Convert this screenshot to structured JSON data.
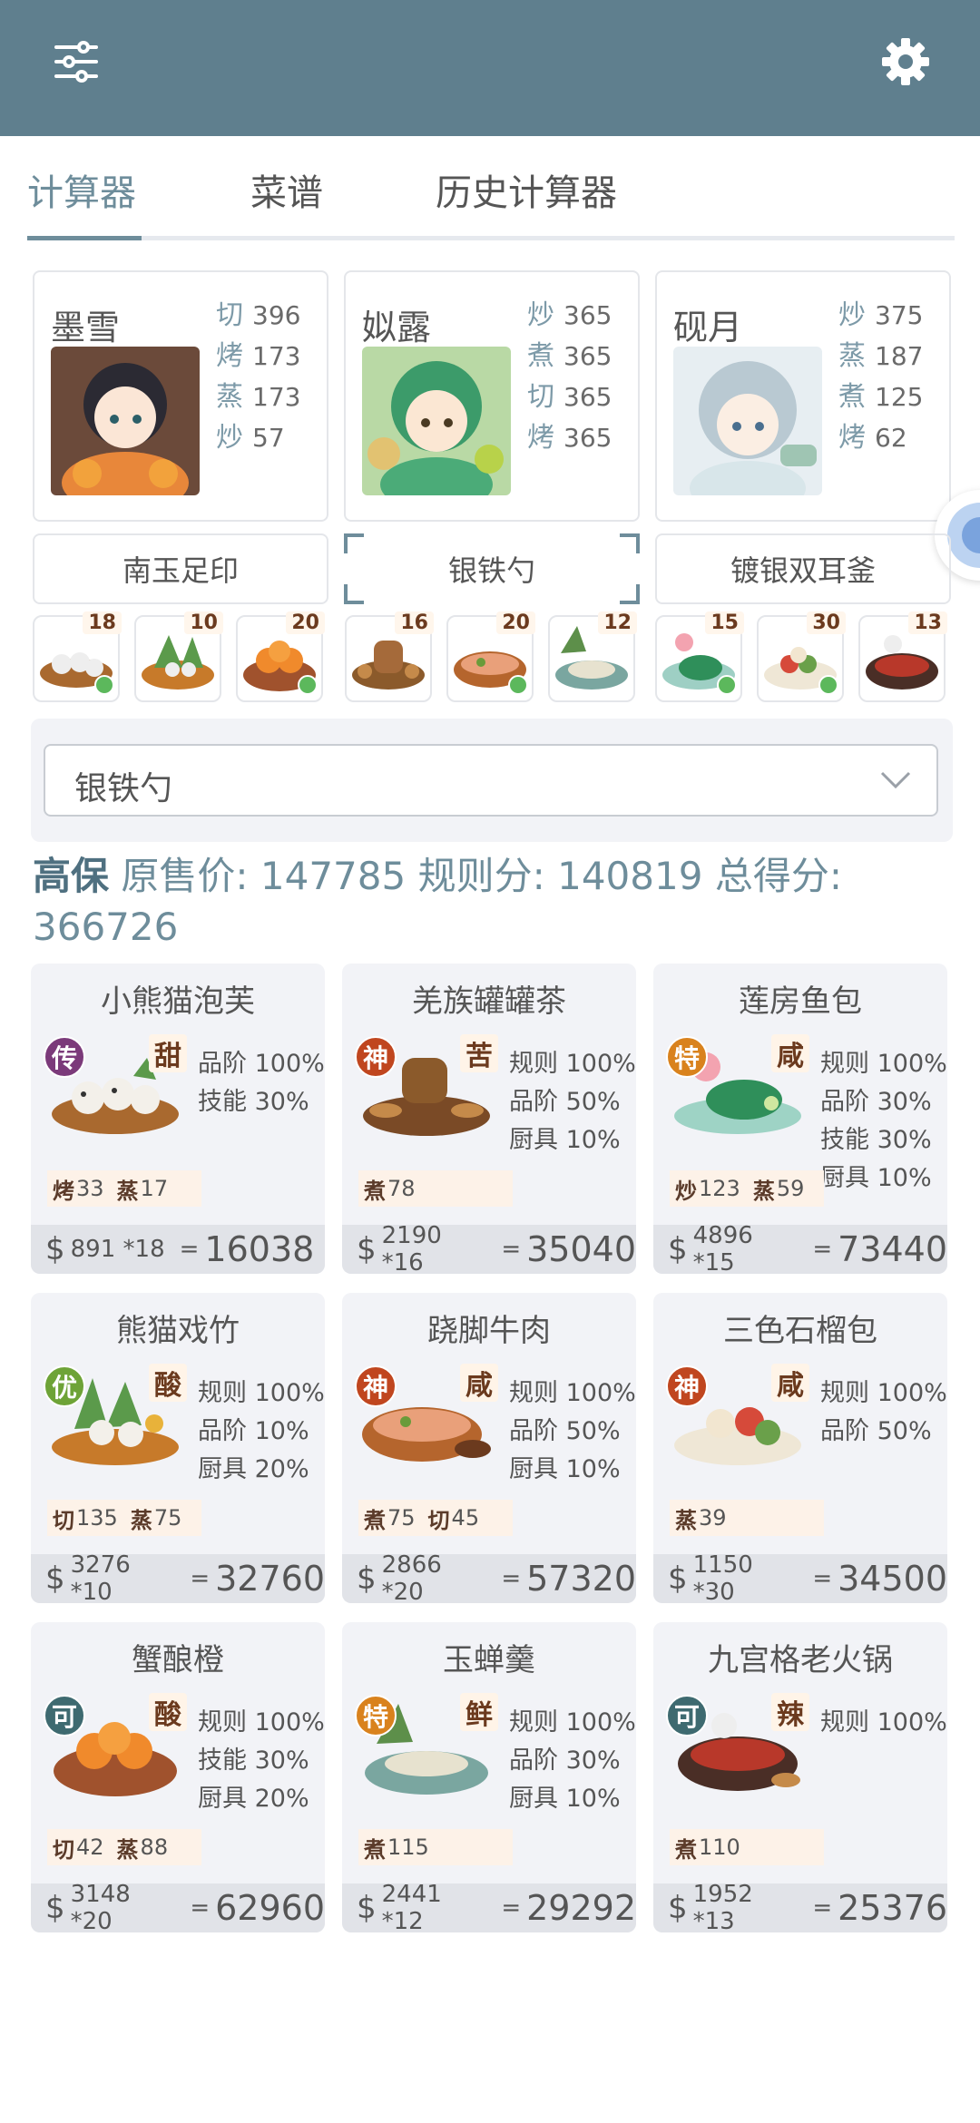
{
  "tabs": [
    "计算器",
    "菜谱",
    "历史计算器"
  ],
  "chefs": [
    {
      "name": "墨雪",
      "stats": [
        {
          "k": "切",
          "v": "396"
        },
        {
          "k": "烤",
          "v": "173"
        },
        {
          "k": "蒸",
          "v": "173"
        },
        {
          "k": "炒",
          "v": "57"
        }
      ]
    },
    {
      "name": "姒露",
      "stats": [
        {
          "k": "炒",
          "v": "365"
        },
        {
          "k": "煮",
          "v": "365"
        },
        {
          "k": "切",
          "v": "365"
        },
        {
          "k": "烤",
          "v": "365"
        }
      ]
    },
    {
      "name": "砚月",
      "stats": [
        {
          "k": "炒",
          "v": "375"
        },
        {
          "k": "蒸",
          "v": "187"
        },
        {
          "k": "煮",
          "v": "125"
        },
        {
          "k": "烤",
          "v": "62"
        }
      ]
    }
  ],
  "tools": [
    "南玉足印",
    "银铁勺",
    "镀银双耳釜"
  ],
  "dish_counts": [
    "18",
    "10",
    "20",
    "16",
    "20",
    "12",
    "15",
    "30",
    "13"
  ],
  "selected_option": "银铁勺",
  "summary": {
    "label": "高保",
    "orig_label": "原售价:",
    "orig": "147785",
    "rule_label": "规则分:",
    "rule": "140819",
    "total_label": "总得分:",
    "total": "366726"
  },
  "colors": {
    "header": "#5f7f8e",
    "accent": "#6e8d9b"
  },
  "dishes": [
    {
      "name": "小熊猫泡芙",
      "rank": "传",
      "rank_color": "#7b3a7a",
      "taste": "甜",
      "mods": [
        "品阶 100%",
        "技能 30%"
      ],
      "skills": [
        {
          "k": "烤",
          "v": "33"
        },
        {
          "k": "蒸",
          "v": "17"
        }
      ],
      "price": "891",
      "mult": "*18",
      "eq": "=",
      "total": "16038"
    },
    {
      "name": "羌族罐罐茶",
      "rank": "神",
      "rank_color": "#c0461f",
      "taste": "苦",
      "mods": [
        "规则 100%",
        "品阶 50%",
        "厨具 10%"
      ],
      "skills": [
        {
          "k": "煮",
          "v": "78"
        }
      ],
      "price": "2190",
      "mult": "*16",
      "eq": "=",
      "total": "35040"
    },
    {
      "name": "莲房鱼包",
      "rank": "特",
      "rank_color": "#d9821d",
      "taste": "咸",
      "mods": [
        "规则 100%",
        "品阶 30%",
        "技能 30%",
        "厨具 10%"
      ],
      "skills": [
        {
          "k": "炒",
          "v": "123"
        },
        {
          "k": "蒸",
          "v": "59"
        }
      ],
      "price": "4896",
      "mult": "*15",
      "eq": "=",
      "total": "73440"
    },
    {
      "name": "熊猫戏竹",
      "rank": "优",
      "rank_color": "#6ea337",
      "taste": "酸",
      "mods": [
        "规则 100%",
        "品阶 10%",
        "厨具 20%"
      ],
      "skills": [
        {
          "k": "切",
          "v": "135"
        },
        {
          "k": "蒸",
          "v": "75"
        }
      ],
      "price": "3276",
      "mult": "*10",
      "eq": "=",
      "total": "32760"
    },
    {
      "name": "跷脚牛肉",
      "rank": "神",
      "rank_color": "#c0461f",
      "taste": "咸",
      "mods": [
        "规则 100%",
        "品阶 50%",
        "厨具 10%"
      ],
      "skills": [
        {
          "k": "煮",
          "v": "75"
        },
        {
          "k": "切",
          "v": "45"
        }
      ],
      "price": "2866",
      "mult": "*20",
      "eq": "=",
      "total": "57320"
    },
    {
      "name": "三色石榴包",
      "rank": "神",
      "rank_color": "#c0461f",
      "taste": "咸",
      "mods": [
        "规则 100%",
        "品阶 50%"
      ],
      "skills": [
        {
          "k": "蒸",
          "v": "39"
        }
      ],
      "price": "1150",
      "mult": "*30",
      "eq": "=",
      "total": "34500"
    },
    {
      "name": "蟹酿橙",
      "rank": "可",
      "rank_color": "#3e6a70",
      "taste": "酸",
      "mods": [
        "规则 100%",
        "技能 30%",
        "厨具 20%"
      ],
      "skills": [
        {
          "k": "切",
          "v": "42"
        },
        {
          "k": "蒸",
          "v": "88"
        }
      ],
      "price": "3148",
      "mult": "*20",
      "eq": "=",
      "total": "62960"
    },
    {
      "name": "玉蝉羹",
      "rank": "特",
      "rank_color": "#d9821d",
      "taste": "鲜",
      "mods": [
        "规则 100%",
        "品阶 30%",
        "厨具 10%"
      ],
      "skills": [
        {
          "k": "煮",
          "v": "115"
        }
      ],
      "price": "2441",
      "mult": "*12",
      "eq": "=",
      "total": "29292"
    },
    {
      "name": "九宫格老火锅",
      "rank": "可",
      "rank_color": "#3e6a70",
      "taste": "辣",
      "mods": [
        "规则 100%"
      ],
      "skills": [
        {
          "k": "煮",
          "v": "110"
        }
      ],
      "price": "1952",
      "mult": "*13",
      "eq": "=",
      "total": "25376"
    }
  ]
}
